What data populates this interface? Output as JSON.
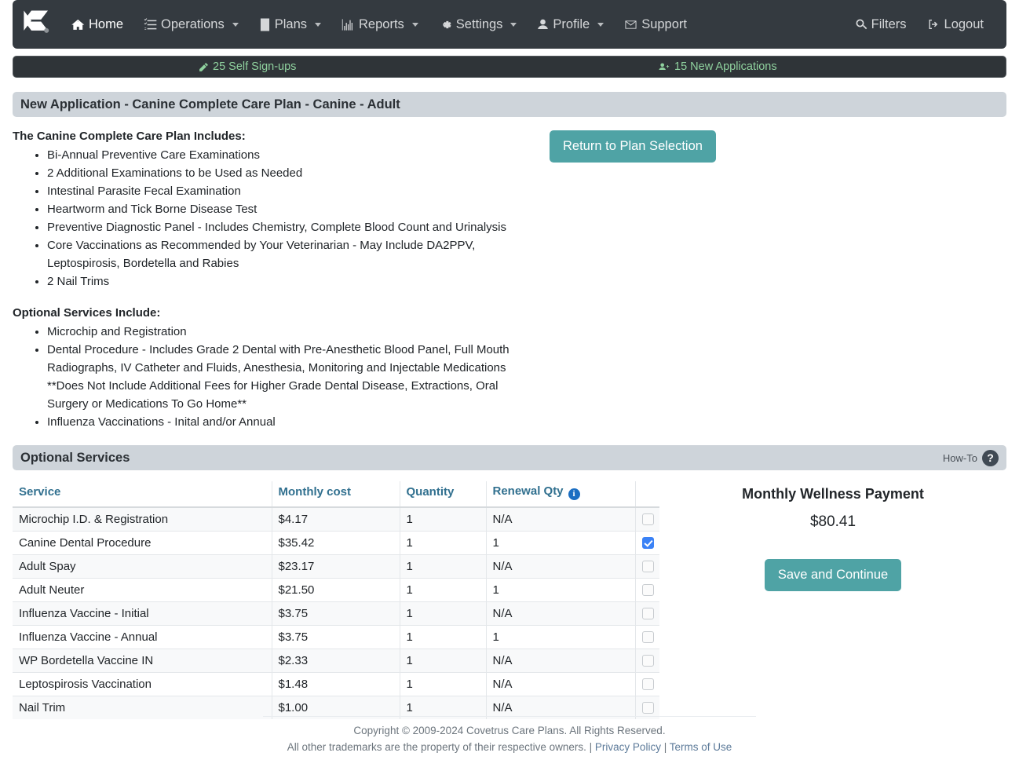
{
  "navbar": {
    "logo_name": "covetrus-logo",
    "items": [
      {
        "label": "Home",
        "icon": "home-icon",
        "caret": false,
        "key": "home"
      },
      {
        "label": "Operations",
        "icon": "tasks-icon",
        "caret": true,
        "key": "operations"
      },
      {
        "label": "Plans",
        "icon": "book-icon",
        "caret": true,
        "key": "plans"
      },
      {
        "label": "Reports",
        "icon": "chart-icon",
        "caret": true,
        "key": "reports"
      },
      {
        "label": "Settings",
        "icon": "gear-icon",
        "caret": true,
        "key": "settings"
      },
      {
        "label": "Profile",
        "icon": "user-icon",
        "caret": true,
        "key": "profile"
      },
      {
        "label": "Support",
        "icon": "envelope-icon",
        "caret": false,
        "key": "support"
      }
    ],
    "right": [
      {
        "label": "Filters",
        "icon": "search-icon",
        "key": "filters"
      },
      {
        "label": "Logout",
        "icon": "logout-icon",
        "key": "logout"
      }
    ]
  },
  "notifications": {
    "self_signups": "25 Self Sign-ups",
    "new_applications": "15 New Applications",
    "accent_color": "#8fd19e"
  },
  "page_header": {
    "title": "New Application - Canine Complete Care Plan - Canine - Adult"
  },
  "plan_description": {
    "includes_title": "The Canine Complete Care Plan Includes:",
    "includes_items": [
      "Bi-Annual Preventive Care Examinations",
      "2 Additional Examinations to be Used as Needed",
      "Intestinal Parasite Fecal Examination",
      "Heartworm and Tick Borne Disease Test",
      "Preventive Diagnostic Panel - Includes Chemistry, Complete Blood Count and Urinalysis",
      "Core Vaccinations as Recommended by Your Veterinarian - May Include DA2PPV, Leptospirosis, Bordetella and Rabies",
      "2 Nail Trims"
    ],
    "optional_title": "Optional Services Include:",
    "optional_items": [
      "Microchip and Registration",
      "Dental Procedure - Includes Grade 2 Dental with Pre-Anesthetic Blood Panel, Full Mouth Radiographs, IV Catheter and Fluids, Anesthesia, Monitoring and Injectable Medications **Does Not Include Additional Fees for Higher Grade Dental Disease, Extractions, Oral Surgery or Medications To Go Home**",
      "Influenza Vaccinations - Inital and/or Annual"
    ],
    "return_button": "Return to Plan Selection"
  },
  "optional_services": {
    "panel_title": "Optional Services",
    "howto_label": "How-To",
    "howto_icon_glyph": "?",
    "columns": [
      "Service",
      "Monthly cost",
      "Quantity",
      "Renewal Qty"
    ],
    "renewal_info_glyph": "i",
    "header_color": "#31708f",
    "rows": [
      {
        "service": "Microchip I.D. & Registration",
        "cost": "$4.17",
        "qty": "1",
        "renewal": "N/A",
        "checked": false
      },
      {
        "service": "Canine Dental Procedure",
        "cost": "$35.42",
        "qty": "1",
        "renewal": "1",
        "checked": true
      },
      {
        "service": "Adult Spay",
        "cost": "$23.17",
        "qty": "1",
        "renewal": "N/A",
        "checked": false
      },
      {
        "service": "Adult Neuter",
        "cost": "$21.50",
        "qty": "1",
        "renewal": "1",
        "checked": false
      },
      {
        "service": "Influenza Vaccine - Initial",
        "cost": "$3.75",
        "qty": "1",
        "renewal": "N/A",
        "checked": false
      },
      {
        "service": "Influenza Vaccine - Annual",
        "cost": "$3.75",
        "qty": "1",
        "renewal": "1",
        "checked": false
      },
      {
        "service": "WP Bordetella Vaccine IN",
        "cost": "$2.33",
        "qty": "1",
        "renewal": "N/A",
        "checked": false
      },
      {
        "service": "Leptospirosis Vaccination",
        "cost": "$1.48",
        "qty": "1",
        "renewal": "N/A",
        "checked": false
      },
      {
        "service": "Nail Trim",
        "cost": "$1.00",
        "qty": "1",
        "renewal": "N/A",
        "checked": false
      }
    ]
  },
  "summary": {
    "title": "Monthly Wellness Payment",
    "amount": "$80.41",
    "save_button": "Save and Continue",
    "button_color": "#4fa3a5"
  },
  "footer": {
    "copyright": "Copyright © 2009-2024 Covetrus Care Plans. All Rights Reserved.",
    "trademark": "All other trademarks are the property of their respective owners. |",
    "privacy_link": "Privacy Policy",
    "separator": "|",
    "terms_link": "Terms of Use"
  }
}
